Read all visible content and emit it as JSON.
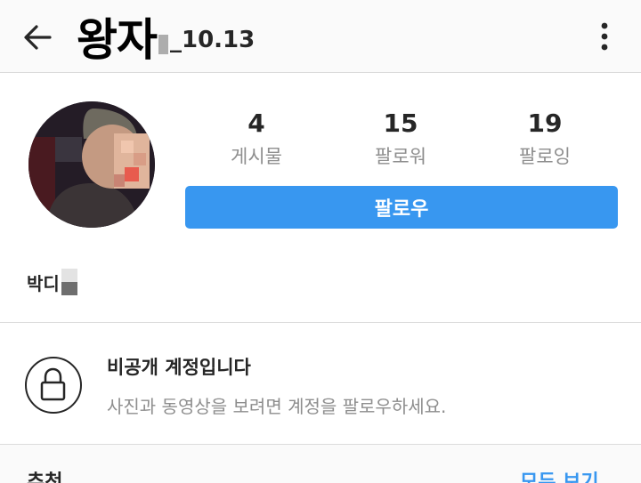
{
  "header": {
    "title_main": "왕자",
    "title_suffix": "_10.13",
    "back_icon": "arrow-left-icon",
    "menu_icon": "more-vertical-icon"
  },
  "profile": {
    "stats": [
      {
        "value": "4",
        "label": "게시물"
      },
      {
        "value": "15",
        "label": "팔로워"
      },
      {
        "value": "19",
        "label": "팔로잉"
      }
    ],
    "follow_label": "팔로우",
    "name": "박디"
  },
  "private_notice": {
    "icon": "lock-icon",
    "title": "비공개 계정입니다",
    "subtitle": "사진과 동영상을 보려면 계정을 팔로우하세요."
  },
  "suggestions": {
    "label": "추천",
    "see_all": "모두 보기"
  },
  "colors": {
    "accent": "#3897f0",
    "text": "#262626",
    "muted": "#8e8e8e",
    "border": "#dbdbdb"
  }
}
